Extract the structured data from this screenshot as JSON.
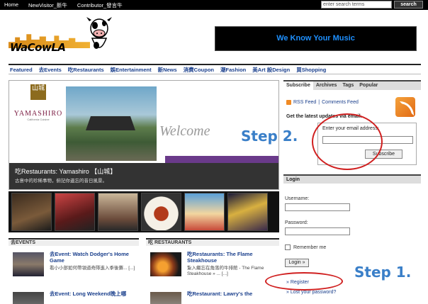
{
  "topbar": {
    "links": [
      "Home",
      "NewVisitor_新牛",
      "Contributor_發言牛"
    ],
    "search_placeholder": "enter search terms",
    "search_label": "search"
  },
  "logo": {
    "text": "WaCowLA"
  },
  "banner": {
    "text": "We Know Your Music"
  },
  "nav": {
    "items": [
      "Featured",
      "去Events",
      "吃Restaurants",
      "娛Entertainment",
      "新News",
      "消費Coupon",
      "潮Fashion",
      "美Art 設Design",
      "買Shopping"
    ]
  },
  "featured": {
    "brand_badge": "山城",
    "brand_name": "YAMASHIRO",
    "brand_sub": "California Cuisine",
    "welcome": "Welcome",
    "title": "吃Restaurants: Yamashiro 【山城】",
    "desc": "古意中的珍稀事物，俯記你遺忘的昔日風景。"
  },
  "events_column": {
    "header": "去EVENTS",
    "posts": [
      {
        "title": "去Event: Watch Dodger's Home Game",
        "desc": "看小小部如何帶領道奇隊進入季後賽... [...]"
      },
      {
        "title": "去Event: Long Weekend晚上哪",
        "desc": ""
      }
    ]
  },
  "restaurants_column": {
    "header": "吃 RESTAURANTS",
    "posts": [
      {
        "title": "吃Restaurants: The Flame Steakhouse",
        "desc": "紮入繼忘在角落的牛排館 - The Flame Steakhouse » ... [...]"
      },
      {
        "title": "吃Restaurant: Lawry's the",
        "desc": ""
      }
    ]
  },
  "sidebar": {
    "tabs": [
      "Subscribe",
      "Archives",
      "Tags",
      "Popular"
    ],
    "rss_feed": "RSS Feed",
    "comments_feed": "Comments Feed",
    "get_latest": "Get the latest updates via email.",
    "email_label": "Enter your email address:",
    "subscribe_button": "Subscribe",
    "login_header": "Login",
    "username_label": "Username:",
    "password_label": "Password:",
    "remember_label": "Remember me",
    "login_button": "Login »",
    "register_link": "» Register",
    "lost_password_link": "» Lost your password?"
  },
  "annotations": {
    "step2": "Step 2.",
    "step1": "Step 1."
  },
  "colors": {
    "nav_link": "#1a3f8c",
    "annotation_blue": "#3a7fc8",
    "annotation_red": "#d02020",
    "banner_text": "#1e90ff"
  }
}
